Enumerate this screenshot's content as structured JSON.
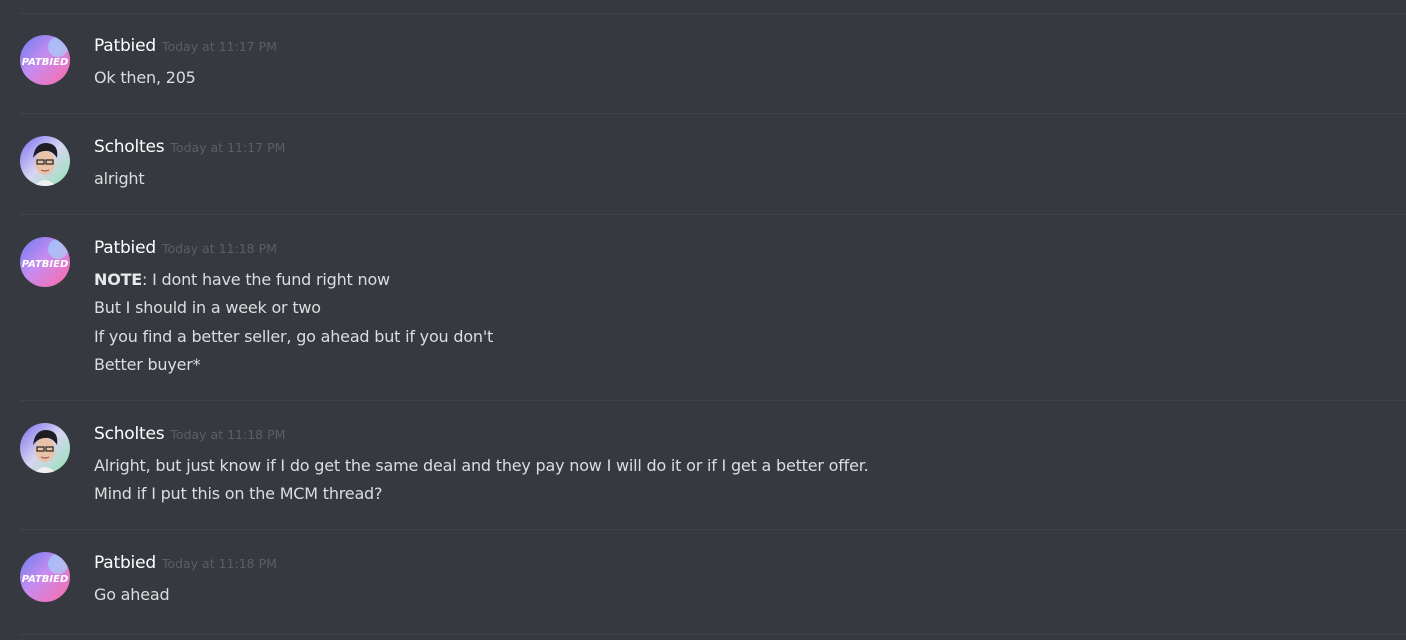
{
  "messages": [
    {
      "author": "Patbied",
      "timestamp": "Today at 11:17 PM",
      "avatar_text": "PATBIED",
      "lines": [
        {
          "text": "Ok then, 205"
        }
      ]
    },
    {
      "author": "Scholtes",
      "timestamp": "Today at 11:17 PM",
      "lines": [
        {
          "text": "alright"
        }
      ]
    },
    {
      "author": "Patbied",
      "timestamp": "Today at 11:18 PM",
      "avatar_text": "PATBIED",
      "lines": [
        {
          "bold": "NOTE",
          "text": ": I dont have the fund right now"
        },
        {
          "text": "But I should in a week or two"
        },
        {
          "text": "If you find a better seller, go ahead but if you don't"
        },
        {
          "text": "Better buyer*"
        }
      ]
    },
    {
      "author": "Scholtes",
      "timestamp": "Today at 11:18 PM",
      "lines": [
        {
          "text": "Alright, but just know if I do get the same deal and they pay now I will do it or if I get a better offer."
        },
        {
          "text": "Mind if I put this on the MCM thread?"
        }
      ]
    },
    {
      "author": "Patbied",
      "timestamp": "Today at 11:18 PM",
      "avatar_text": "PATBIED",
      "lines": [
        {
          "text": "Go ahead"
        }
      ]
    }
  ],
  "colors": {
    "background": "#36393f",
    "divider": "#40434a",
    "username": "#ffffff",
    "timestamp": "#5a5e66",
    "message_text": "#dcddde"
  }
}
